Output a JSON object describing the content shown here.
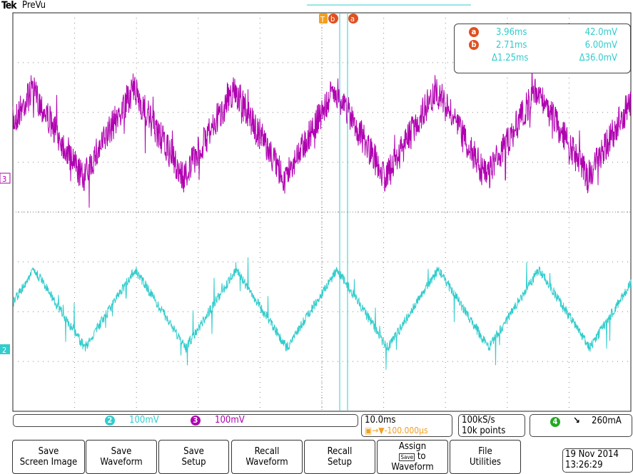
{
  "header": {
    "brand": "Tek",
    "mode": "PreVu"
  },
  "colors": {
    "ch2": "#33cccc",
    "ch3": "#b000b0",
    "ch4": "#22aa22",
    "cursor": "#e05020",
    "trigger": "#f0a020"
  },
  "cursors": {
    "a": {
      "label": "a",
      "time": "3.96ms",
      "value": "42.0mV"
    },
    "b": {
      "label": "b",
      "time": "2.71ms",
      "value": "6.00mV"
    },
    "delta": {
      "time": "Δ1.25ms",
      "value": "Δ36.0mV"
    }
  },
  "markers": {
    "trigger": "T",
    "ch3": "3",
    "ch2": "2"
  },
  "channels": [
    {
      "num": "2",
      "scale": "100mV"
    },
    {
      "num": "3",
      "scale": "100mV"
    }
  ],
  "horizontal": {
    "scale": "10.0ms",
    "delay": "-100.000µs"
  },
  "acquisition": {
    "rate": "100kS/s",
    "points": "10k points"
  },
  "trigger": {
    "source": "4",
    "slope": "falling",
    "level": "260mA"
  },
  "buttons": [
    {
      "line1": "Save",
      "line2": "Screen Image"
    },
    {
      "line1": "Save",
      "line2": "Waveform"
    },
    {
      "line1": "Save",
      "line2": "Setup"
    },
    {
      "line1": "Recall",
      "line2": "Waveform"
    },
    {
      "line1": "Recall",
      "line2": "Setup"
    },
    {
      "line1": "Assign",
      "mid": "Save",
      "line2": "to",
      "line3": "Waveform"
    },
    {
      "line1": "File",
      "line2": "Utilities"
    }
  ],
  "datetime": {
    "date": "19 Nov 2014",
    "time": "13:26:29"
  }
}
